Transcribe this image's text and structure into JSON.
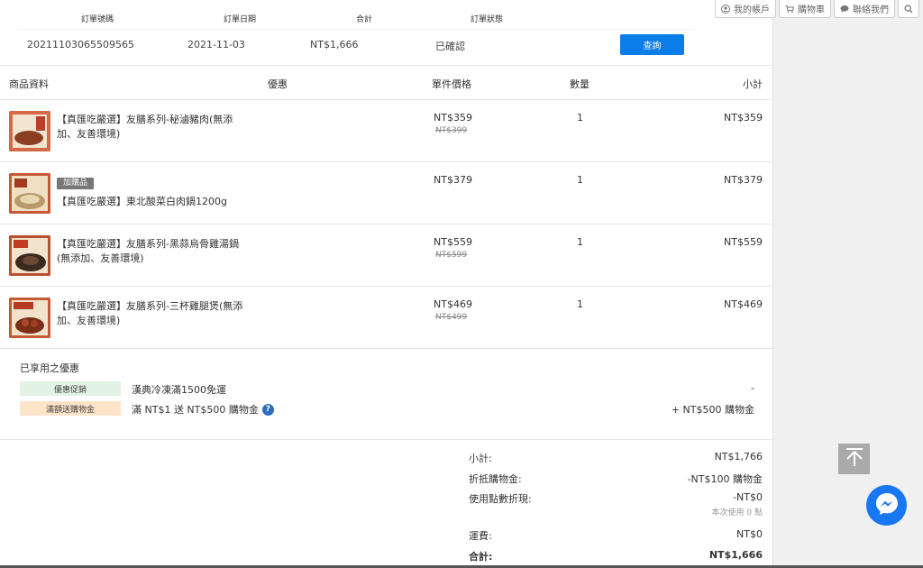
{
  "top_links": {
    "account": "我的帳戶",
    "cart": "購物車",
    "contact": "聯絡我們"
  },
  "order": {
    "headers": [
      "訂單號碼",
      "訂單日期",
      "合計",
      "訂單狀態"
    ],
    "number": "20211103065509565",
    "date": "2021-11-03",
    "total": "NT$1,666",
    "status": "已確認",
    "query_label": "查詢"
  },
  "products": {
    "headers": {
      "info": "商品資料",
      "discount": "優惠",
      "unit_price": "單件價格",
      "quantity": "數量",
      "subtotal": "小計"
    },
    "items": [
      {
        "tag": "",
        "name": "【真匯吃嚴選】友膳系列-秘滷豬肉(無添加、友善環境)",
        "price": "NT$359",
        "old_price": "NT$399",
        "qty": "1",
        "subtotal": "NT$359"
      },
      {
        "tag": "加購品",
        "name": "【真匯吃嚴選】東北酸菜白肉鍋1200g",
        "price": "NT$379",
        "old_price": "",
        "qty": "1",
        "subtotal": "NT$379"
      },
      {
        "tag": "",
        "name": "【真匯吃嚴選】友膳系列-黑蒜烏骨雞湯鍋(無添加、友善環境)",
        "price": "NT$559",
        "old_price": "NT$599",
        "qty": "1",
        "subtotal": "NT$559"
      },
      {
        "tag": "",
        "name": "【真匯吃嚴選】友膳系列-三杯雞腿煲(無添加、友善環境)",
        "price": "NT$469",
        "old_price": "NT$499",
        "qty": "1",
        "subtotal": "NT$469"
      }
    ]
  },
  "promotions": {
    "title": "已享用之優惠",
    "lines": [
      {
        "tag": "優惠促銷",
        "desc": "漢典冷凍滿1500免運",
        "value": "-"
      },
      {
        "tag": "滿額送購物金",
        "desc": "滿 NT$1 送 NT$500 購物金",
        "value": "+ NT$500 購物金"
      }
    ]
  },
  "summary": {
    "subtotal_label": "小計:",
    "subtotal_value": "NT$1,766",
    "credit_label": "折抵購物金:",
    "credit_value": "-NT$100 購物金",
    "points_label": "使用點數折現:",
    "points_value": "-NT$0",
    "points_hint": "本次使用 0 點",
    "shipping_label": "運費:",
    "shipping_value": "NT$0",
    "total_label": "合計:",
    "total_value": "NT$1,666"
  },
  "colors": {
    "primary_button": "#0b7de8",
    "messenger": "#1877f2",
    "promo_green": "#e2f2e4",
    "promo_orange": "#fde3c8"
  },
  "icons": [
    "user-icon",
    "cart-icon",
    "chat-icon",
    "search-icon",
    "help-icon",
    "back-to-top-icon",
    "messenger-icon"
  ]
}
